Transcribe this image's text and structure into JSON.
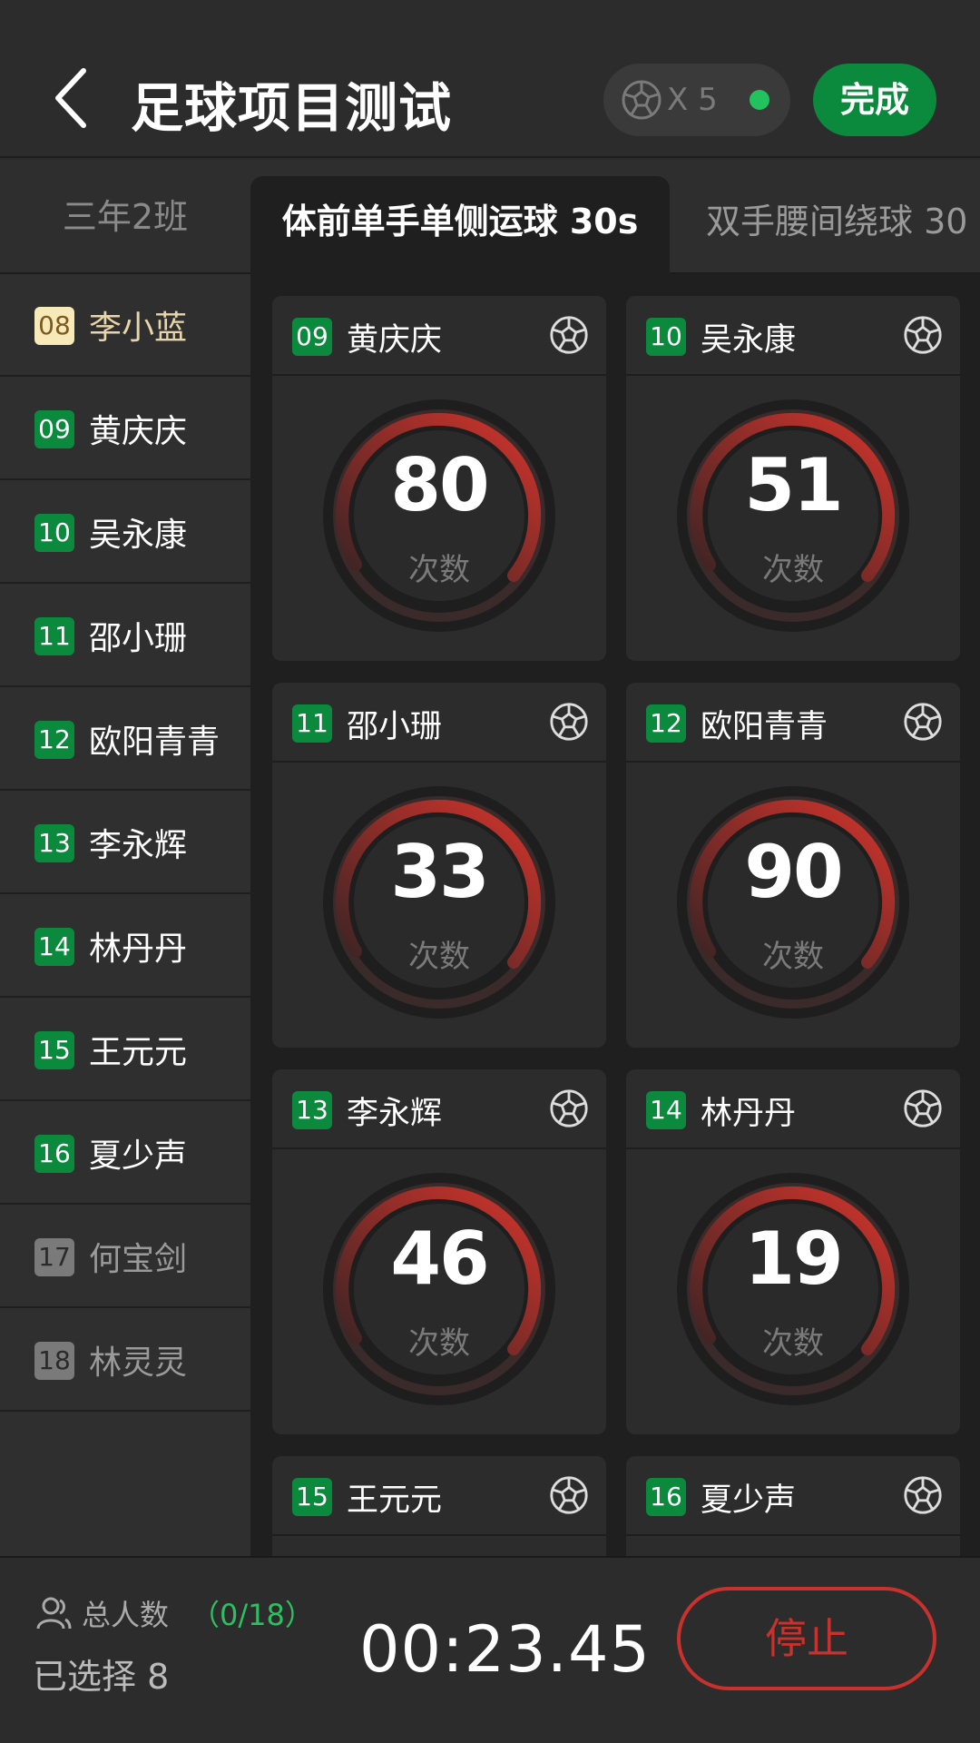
{
  "header": {
    "title": "足球项目测试",
    "ball_count": "X 5",
    "done_label": "完成"
  },
  "tabs": {
    "class_name": "三年2班",
    "active_test": "体前单手单侧运球 30s",
    "next_test": "双手腰间绕球 30"
  },
  "sidebar": {
    "students": [
      {
        "num": "08",
        "name": "李小蓝",
        "state": "selected"
      },
      {
        "num": "09",
        "name": "黄庆庆",
        "state": "normal"
      },
      {
        "num": "10",
        "name": "吴永康",
        "state": "normal"
      },
      {
        "num": "11",
        "name": "邵小珊",
        "state": "normal"
      },
      {
        "num": "12",
        "name": "欧阳青青",
        "state": "normal"
      },
      {
        "num": "13",
        "name": "李永辉",
        "state": "normal"
      },
      {
        "num": "14",
        "name": "林丹丹",
        "state": "normal"
      },
      {
        "num": "15",
        "name": "王元元",
        "state": "normal"
      },
      {
        "num": "16",
        "name": "夏少声",
        "state": "normal"
      },
      {
        "num": "17",
        "name": "何宝剑",
        "state": "absent"
      },
      {
        "num": "18",
        "name": "林灵灵",
        "state": "absent"
      }
    ]
  },
  "cards": [
    {
      "num": "09",
      "name": "黄庆庆",
      "value": "80",
      "unit": "次数"
    },
    {
      "num": "10",
      "name": "吴永康",
      "value": "51",
      "unit": "次数"
    },
    {
      "num": "11",
      "name": "邵小珊",
      "value": "33",
      "unit": "次数"
    },
    {
      "num": "12",
      "name": "欧阳青青",
      "value": "90",
      "unit": "次数"
    },
    {
      "num": "13",
      "name": "李永辉",
      "value": "46",
      "unit": "次数"
    },
    {
      "num": "14",
      "name": "林丹丹",
      "value": "19",
      "unit": "次数"
    },
    {
      "num": "15",
      "name": "王元元",
      "value": "",
      "unit": ""
    },
    {
      "num": "16",
      "name": "夏少声",
      "value": "",
      "unit": ""
    }
  ],
  "footer": {
    "total_label": "总人数",
    "total_count": "（0/18）",
    "selected_label": "已选择 8",
    "timer": "00:23.45",
    "stop_label": "停止"
  },
  "colors": {
    "accent_green": "#0b8a3e",
    "status_dot": "#22c35e",
    "stop_red": "#c8312c",
    "gauge_red": "#c8312c"
  },
  "icons": {
    "back": "chevron-left-icon",
    "ball": "soccer-ball-icon",
    "people": "user-icon"
  }
}
